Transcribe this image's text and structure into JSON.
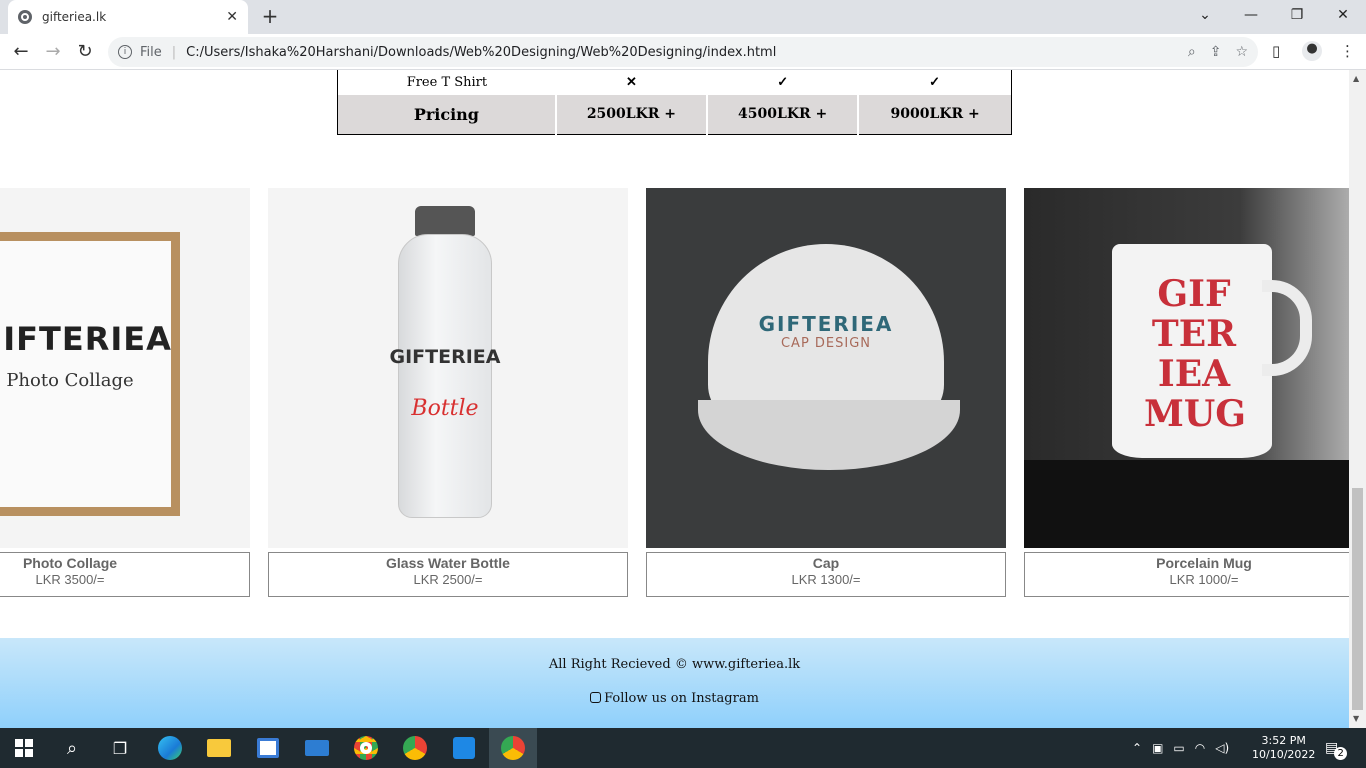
{
  "browser": {
    "tab_title": "gifteriea.lk",
    "address_prefix": "File",
    "url": "C:/Users/Ishaka%20Harshani/Downloads/Web%20Designing/Web%20Designing/index.html"
  },
  "pricing_table": {
    "row_label": "Free T Shirt",
    "row_marks": [
      "✕",
      "✓",
      "✓"
    ],
    "pricing_label": "Pricing",
    "prices": [
      "2500LKR +",
      "4500LKR +",
      "9000LKR +"
    ]
  },
  "products": [
    {
      "name": "Photo Collage",
      "price": "LKR 3500/=",
      "img_title": "GIFTERIEA",
      "img_sub": "Photo Collage"
    },
    {
      "name": "Glass Water Bottle",
      "price": "LKR 2500/=",
      "img_title": "GIFTERIEA",
      "img_sub": "Bottle"
    },
    {
      "name": "Cap",
      "price": "LKR 1300/=",
      "img_title": "GIFTERIEA",
      "img_sub": "CAP DESIGN"
    },
    {
      "name": "Porcelain Mug",
      "price": "LKR 1000/=",
      "img_lines": [
        "GIF",
        "TER",
        "IEA",
        "MUG"
      ]
    }
  ],
  "footer": {
    "copyright": "All Right Recieved © www.gifteriea.lk",
    "instagram": "Follow us on Instagram"
  },
  "taskbar": {
    "time": "3:52 PM",
    "date": "10/10/2022",
    "notifications": "2"
  }
}
